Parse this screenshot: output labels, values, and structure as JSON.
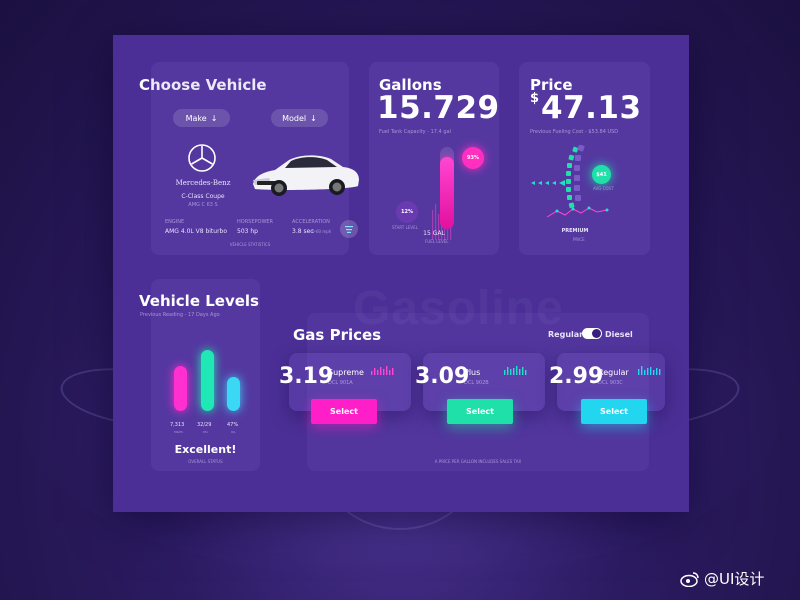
{
  "ghost_text": "Gasoline",
  "choose_vehicle": {
    "title": "Choose Vehicle",
    "make_label": "Make",
    "model_label": "Model",
    "brand": "Mercedes-Benz",
    "model_name": "C-Class Coupe",
    "model_sub": "AMG C 63 S",
    "specs": [
      {
        "label": "ENGINE",
        "value": "AMG 4.0L V8 biturbo"
      },
      {
        "label": "HORSEPOWER",
        "value": "503 hp"
      },
      {
        "label": "ACCELERATION",
        "value": "3.8 sec",
        "unit": "0-60 mph"
      }
    ],
    "footer": "VEHICLE STATISTICS"
  },
  "gallons": {
    "title": "Gallons",
    "value": "15.729",
    "caption": "Fuel Tank Capacity - 17.4 gal",
    "top_badge": "93%",
    "start_badge": "12%",
    "start_label": "START LEVEL",
    "bottom_value": "15 GAL",
    "fuel_level_label": "FUEL LEVEL",
    "fill_fraction": 0.88
  },
  "price": {
    "title": "Price",
    "currency": "$",
    "value": "47.13",
    "caption": "Previous Fueling Cost - $53.84 USD",
    "badge": "$41",
    "badge_caption": "AVG COST",
    "tier": "PREMIUM",
    "price_label": "PRICE"
  },
  "vehicle_levels": {
    "title": "Vehicle Levels",
    "caption": "Previous Reading - 17 Days Ago",
    "bars": [
      {
        "value": "7,313",
        "label": "MILES",
        "level": 0.62,
        "color": "#ff2fd0"
      },
      {
        "value": "32/29",
        "label": "PSI",
        "level": 0.85,
        "color": "#20e8b4"
      },
      {
        "value": "47%",
        "label": "OIL",
        "level": 0.47,
        "color": "#3ad8f5"
      }
    ],
    "status": "Excellent!",
    "status_caption": "OVERALL STATUS"
  },
  "gas_prices": {
    "title": "Gas Prices",
    "toggle_left": "Regular",
    "toggle_right": "Diesel",
    "footer": "A PRICE PER GALLON INCLUDES SALES TAX",
    "items": [
      {
        "price": "3.19",
        "name": "Supreme",
        "code": "DCL 901A",
        "button": "Select",
        "color": "#ff1fc8"
      },
      {
        "price": "3.09",
        "name": "Plus",
        "code": "DCL 902B",
        "button": "Select",
        "color": "#1fe0a8"
      },
      {
        "price": "2.99",
        "name": "Regular",
        "code": "DCL 903C",
        "button": "Select",
        "color": "#22d6f0"
      }
    ]
  },
  "watermark": "@UI设计"
}
